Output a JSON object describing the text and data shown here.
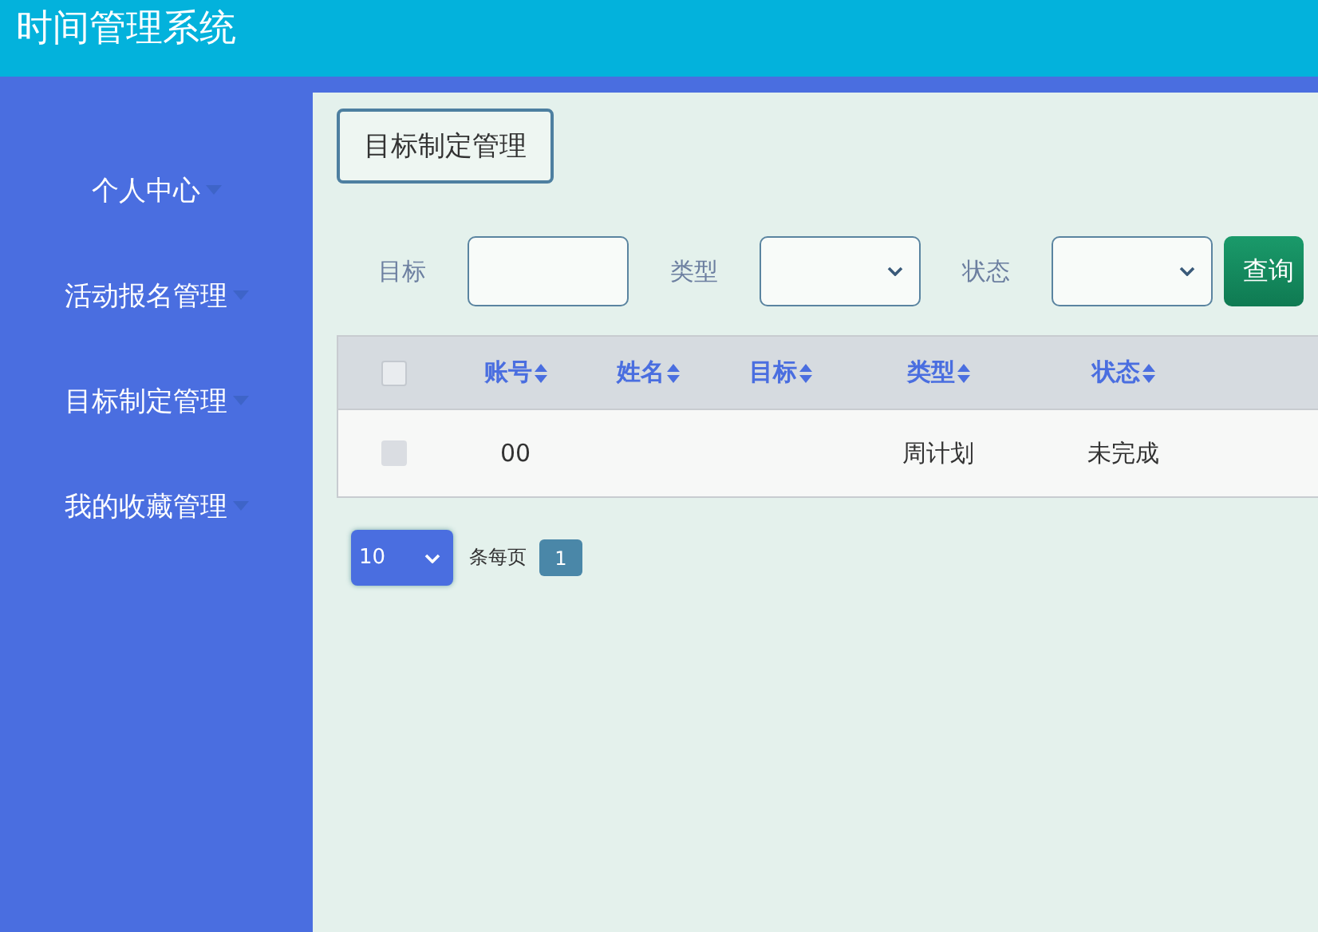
{
  "header": {
    "title": "时间管理系统"
  },
  "sidebar": {
    "items": [
      {
        "label": "个人中心"
      },
      {
        "label": "活动报名管理"
      },
      {
        "label": "目标制定管理"
      },
      {
        "label": "我的收藏管理"
      }
    ]
  },
  "breadcrumb": {
    "label": "目标制定管理"
  },
  "search": {
    "fields": [
      {
        "kind": "input",
        "label": "目标"
      },
      {
        "kind": "select",
        "label": "类型"
      },
      {
        "kind": "select",
        "label": "状态"
      }
    ],
    "button": "查询"
  },
  "table": {
    "select_all": {
      "checked": false
    },
    "columns": [
      {
        "label": "账号"
      },
      {
        "label": "姓名"
      },
      {
        "label": "目标"
      },
      {
        "label": "类型"
      },
      {
        "label": "状态"
      }
    ],
    "rows": [
      {
        "checked": false,
        "account": "00",
        "type": "周计划",
        "status": "未完成"
      }
    ]
  },
  "pagination": {
    "page_size": "10",
    "page_size_label": "条每页",
    "pages": [
      {
        "label": "1",
        "selected": true
      }
    ]
  }
}
